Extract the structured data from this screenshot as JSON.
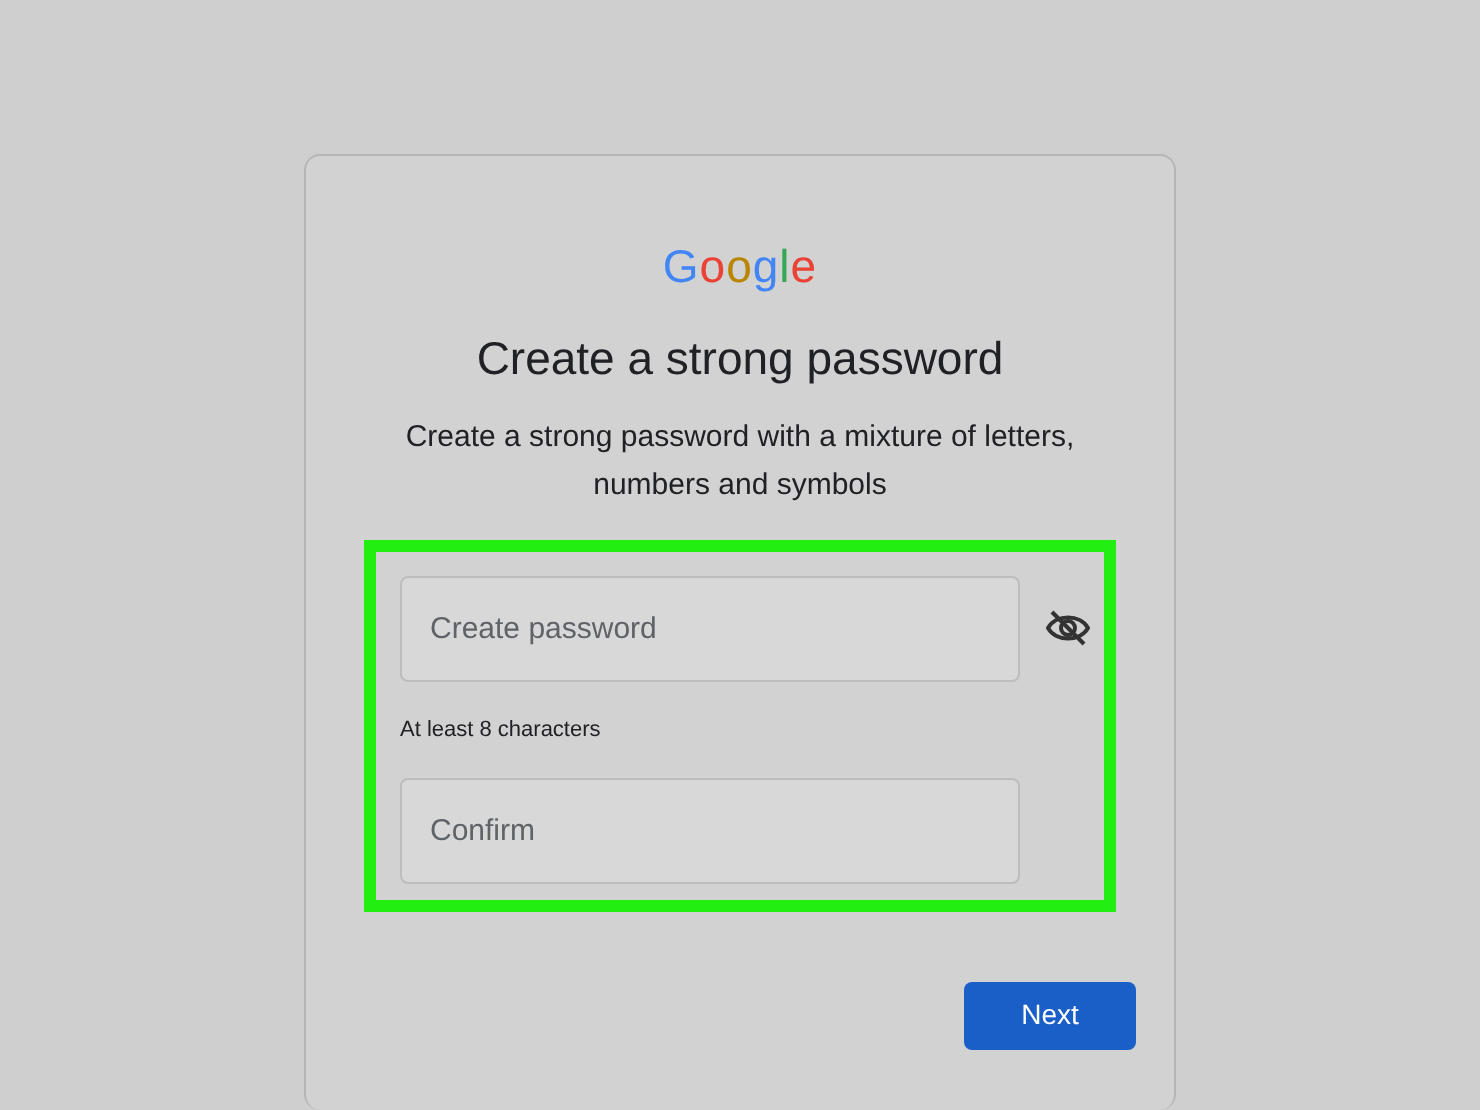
{
  "logo": "Google",
  "title": "Create a strong password",
  "subtitle": "Create a strong password with a mixture of letters, numbers and symbols",
  "highlight": true,
  "password_field": {
    "placeholder": "Create password",
    "show_password": false
  },
  "hint": "At least 8 characters",
  "confirm_field": {
    "placeholder": "Confirm"
  },
  "buttons": [
    "Next"
  ]
}
